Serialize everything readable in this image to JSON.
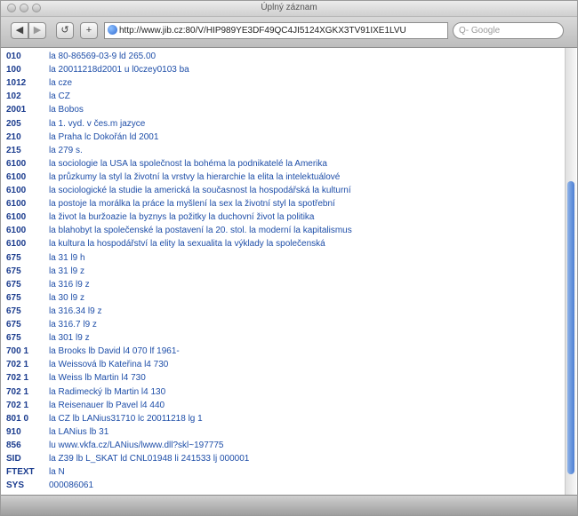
{
  "window": {
    "title": "Úplný záznam"
  },
  "toolbar": {
    "back_label": "◀",
    "forward_label": "▶",
    "reload_label": "↺",
    "add_label": "+",
    "url": "http://www.jib.cz:80/V/HIP989YE3DF49QC4JI5124XGKX3TV91IXE1LVU",
    "search_placeholder": "Q- Google"
  },
  "record": [
    {
      "tag": "010",
      "value": "la 80-86569-03-9 ld 265.00"
    },
    {
      "tag": "100",
      "value": "la 20011218d2001 u l0czey0103 ba"
    },
    {
      "tag": "1012",
      "value": "la cze"
    },
    {
      "tag": "102",
      "value": "la CZ"
    },
    {
      "tag": "2001",
      "value": "la Bobos"
    },
    {
      "tag": "205",
      "value": "la 1. vyd. v čes.m jazyce"
    },
    {
      "tag": "210",
      "value": "la Praha lc Dokořán ld 2001"
    },
    {
      "tag": "215",
      "value": "la 279 s."
    },
    {
      "tag": "6100",
      "value": "la sociologie la USA la společnost la bohéma la podnikatelé la Amerika"
    },
    {
      "tag": "6100",
      "value": "la průzkumy la styl la životní la vrstvy la hierarchie la elita la intelektuálové"
    },
    {
      "tag": "6100",
      "value": "la sociologické la studie la americká la současnost la hospodářská la kulturní"
    },
    {
      "tag": "6100",
      "value": "la postoje la morálka la práce la myšlení la sex la životní styl la spotřební"
    },
    {
      "tag": "6100",
      "value": "la život la buržoazie la byznys la požitky la duchovní život la politika"
    },
    {
      "tag": "6100",
      "value": "la blahobyt la společenské la postavení la 20. stol. la moderní la kapitalismus"
    },
    {
      "tag": "6100",
      "value": "la kultura la hospodářství la elity la sexualita la výklady la společenská"
    },
    {
      "tag": "675",
      "value": "la 31 l9 h"
    },
    {
      "tag": "675",
      "value": "la 31 l9 z"
    },
    {
      "tag": "675",
      "value": "la 316 l9 z"
    },
    {
      "tag": "675",
      "value": "la 30 l9 z"
    },
    {
      "tag": "675",
      "value": "la 316.34 l9 z"
    },
    {
      "tag": "675",
      "value": "la 316.7 l9 z"
    },
    {
      "tag": "675",
      "value": "la 301 l9 z"
    },
    {
      "tag": "700 1",
      "value": "la Brooks lb David l4 070 lf 1961-"
    },
    {
      "tag": "702 1",
      "value": "la Weissová lb Kateřina l4 730"
    },
    {
      "tag": "702 1",
      "value": "la Weiss lb Martin l4 730"
    },
    {
      "tag": "702 1",
      "value": "la Radimecký lb Martin l4 130"
    },
    {
      "tag": "702 1",
      "value": "la Reisenauer lb Pavel l4 440"
    },
    {
      "tag": "801 0",
      "value": "la CZ lb LANius31710 lc 20011218 lg 1"
    },
    {
      "tag": "910",
      "value": "la LANius lb 31"
    },
    {
      "tag": "856",
      "value": "lu www.vkfa.cz/LANius/lwww.dll?skl~197775"
    },
    {
      "tag": "SID",
      "value": "la Z39 lb L_SKAT ld CNL01948 li 241533 lj 000001"
    },
    {
      "tag": "FTEXT",
      "value": "la N"
    },
    {
      "tag": "SYS",
      "value": "000086061"
    }
  ]
}
